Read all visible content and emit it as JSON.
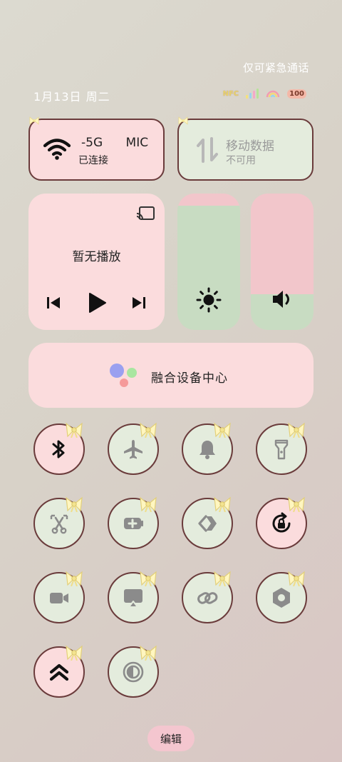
{
  "status": {
    "emergency_text": "仅可紧急通话",
    "date": "1月13日 周二",
    "nfc_label": "NFC",
    "battery_level": "100"
  },
  "quick_tiles": {
    "wifi": {
      "name": "-5G      MIC",
      "state": "已连接"
    },
    "mobile_data": {
      "name": "移动数据",
      "state": "不可用"
    }
  },
  "media": {
    "title": "暂无播放"
  },
  "sliders": {
    "brightness_level": 0.91,
    "volume_level": 0.26,
    "colors": {
      "bg": "#f2c6cb",
      "fill": "#c8dcc2"
    }
  },
  "device_center": {
    "label": "融合设备中心"
  },
  "toggles": [
    {
      "name": "bluetooth",
      "icon": "bluetooth-icon",
      "active": true
    },
    {
      "name": "airplane-mode",
      "icon": "airplane-icon",
      "active": false
    },
    {
      "name": "ring-mode",
      "icon": "bell-icon",
      "active": false
    },
    {
      "name": "flashlight",
      "icon": "flashlight-icon",
      "active": false
    },
    {
      "name": "screenshot",
      "icon": "scissors-icon",
      "active": false
    },
    {
      "name": "battery-saver",
      "icon": "battery-plus-icon",
      "active": false
    },
    {
      "name": "share",
      "icon": "share-icon",
      "active": false
    },
    {
      "name": "rotation-lock",
      "icon": "rotation-lock-icon",
      "active": true
    },
    {
      "name": "screen-record",
      "icon": "camera-icon",
      "active": false
    },
    {
      "name": "screen-cast",
      "icon": "cast-icon",
      "active": false
    },
    {
      "name": "link",
      "icon": "link-icon",
      "active": false
    },
    {
      "name": "settings-hexagon",
      "icon": "hexagon-icon",
      "active": false
    },
    {
      "name": "performance",
      "icon": "double-chevron-up-icon",
      "active": true
    },
    {
      "name": "eye-comfort",
      "icon": "contrast-icon",
      "active": false
    }
  ],
  "footer": {
    "edit_label": "编辑"
  },
  "colors": {
    "pink": "#fbdcdd",
    "green": "#e4ecdd",
    "border": "#6a3b3b"
  }
}
